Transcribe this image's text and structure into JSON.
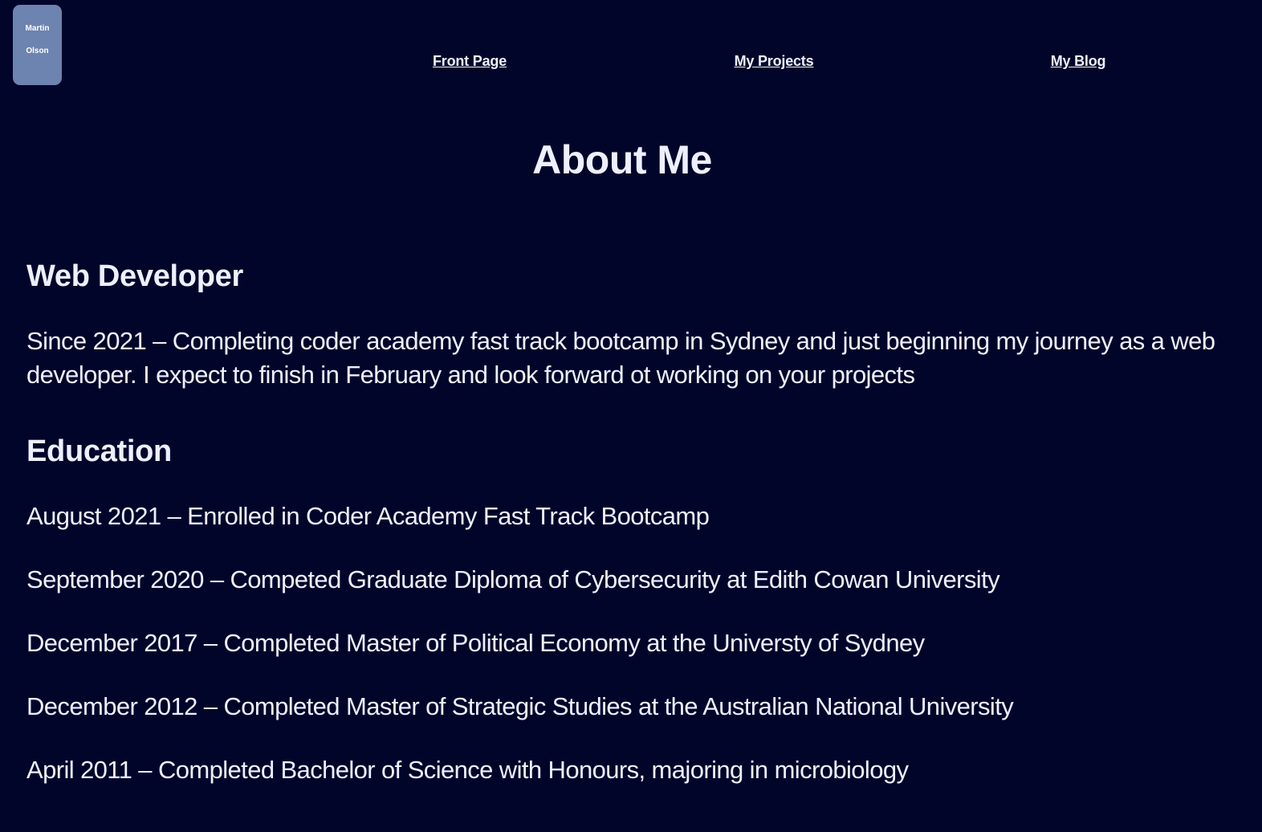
{
  "logo": {
    "first": "Martin",
    "last": "Olson"
  },
  "nav": {
    "items": [
      "Front Page",
      "My Projects",
      "My Blog"
    ]
  },
  "page": {
    "title": "About Me"
  },
  "web_developer": {
    "heading": "Web Developer",
    "text": "Since 2021 – Completing coder academy fast track bootcamp in Sydney and just beginning my journey as a web developer. I expect to finish in February and look forward ot working on your projects"
  },
  "education": {
    "heading": "Education",
    "items": [
      "August 2021 – Enrolled in Coder Academy Fast Track Bootcamp",
      "September 2020 – Competed Graduate Diploma of Cybersecurity at Edith Cowan University",
      "December 2017 – Completed Master of Political Economy at the Universty of Sydney",
      "December 2012 – Completed Master of Strategic Studies at the Australian National University",
      "April 2011 – Completed Bachelor of Science with Honours, majoring in microbiology"
    ]
  },
  "colors": {
    "background": "#02052a",
    "logo_background": "#6d83b0",
    "text": "#eef0ff"
  }
}
